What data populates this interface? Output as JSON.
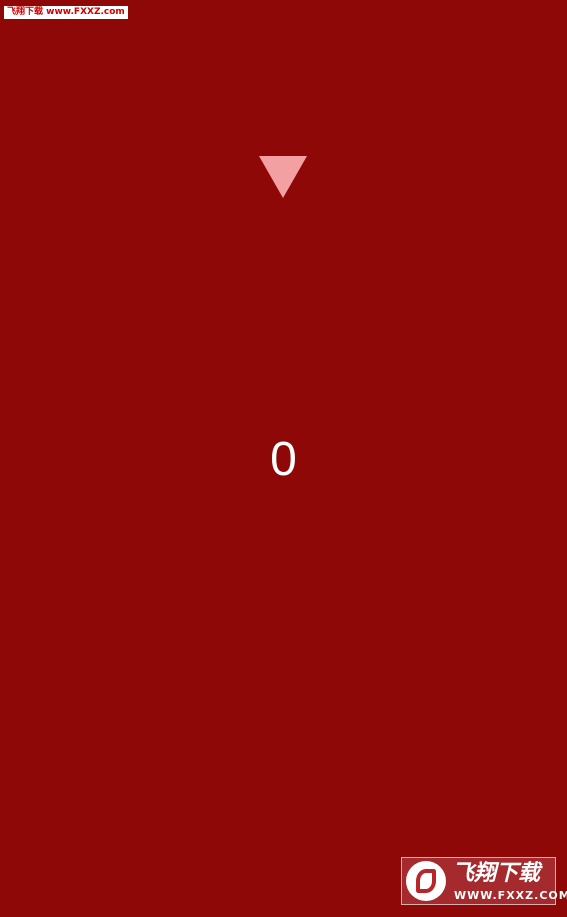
{
  "watermark_top": {
    "text": "飞翔下载 www.FXXZ.com"
  },
  "game": {
    "pointer_icon": "triangle-down-icon",
    "score": "0"
  },
  "watermark_bottom": {
    "brand": "飞翔下载",
    "url": "WWW.FXXZ.COM",
    "logo_icon": "fxxz-logo-icon"
  },
  "colors": {
    "background": "#8f0808",
    "pointer": "#f3a0a3",
    "score_text": "#ffffff"
  }
}
